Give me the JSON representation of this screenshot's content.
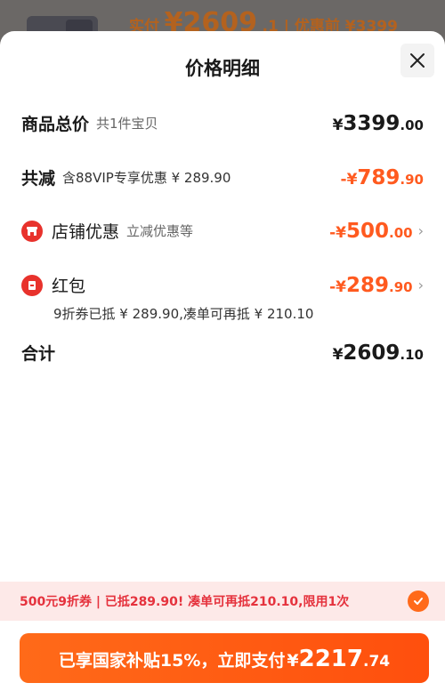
{
  "background": {
    "text_small": "实付",
    "text_big": "¥2609",
    "text_tail": ".1 | 优惠前 ¥3399"
  },
  "sheet": {
    "title": "价格明细",
    "close_icon": "close-icon"
  },
  "rows": {
    "total": {
      "label": "商品总价",
      "sub": "共1件宝贝",
      "cur": "¥",
      "int": "3399",
      "dec": ".00"
    },
    "reduce": {
      "label": "共减",
      "sub": "含88VIP专享优惠 ¥ 289.90",
      "cur": "-¥",
      "int": "789",
      "dec": ".90"
    },
    "store": {
      "label": "店铺优惠",
      "sub": "立减优惠等",
      "cur": "-¥",
      "int": "500",
      "dec": ".00",
      "icon": "store-icon"
    },
    "redpacket": {
      "label": "红包",
      "cur": "-¥",
      "int": "289",
      "dec": ".90",
      "icon": "red-packet-icon",
      "note": "9折券已抵 ¥ 289.90,凑单可再抵 ¥ 210.10"
    },
    "sum": {
      "label": "合计",
      "cur": "¥",
      "int": "2609",
      "dec": ".10"
    }
  },
  "coupon": {
    "text": "500元9折券 | 已抵289.90! 凑单可再抵210.10,限用1次",
    "icon": "check-icon"
  },
  "pay": {
    "text": "已享国家补贴15%，立即支付",
    "cur": "¥",
    "int": "2217",
    "dec": ".74"
  },
  "colors": {
    "accent": "#ff5a1f",
    "red": "#e8322c",
    "banner": "#fde9e8"
  }
}
